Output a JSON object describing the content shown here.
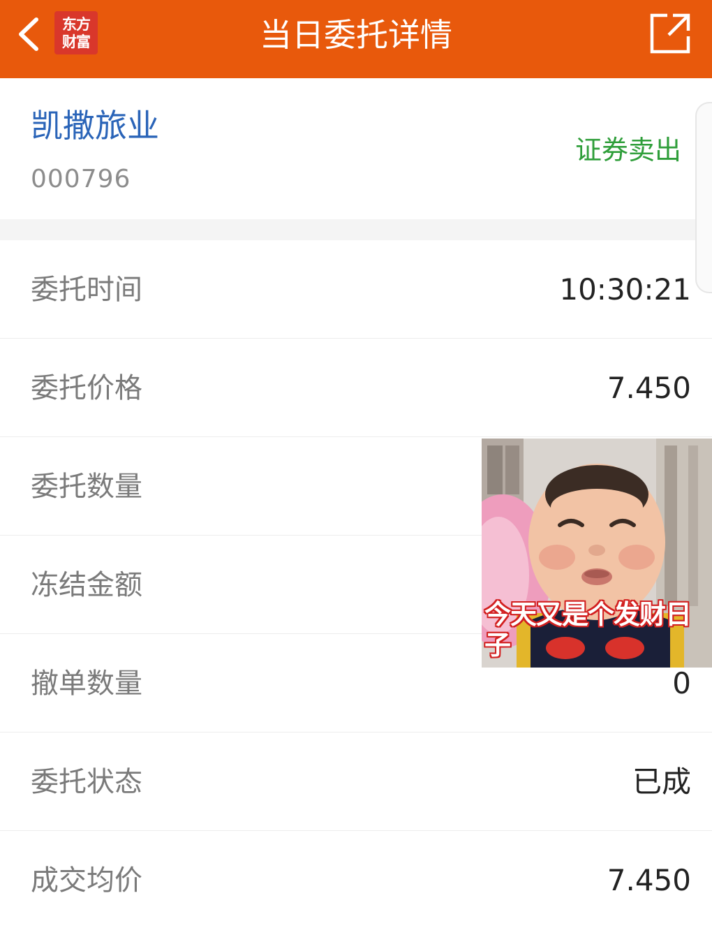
{
  "header": {
    "title": "当日委托详情",
    "logo_line1": "东方",
    "logo_line2": "财富",
    "background_color": "#E8590C",
    "back_icon": "chevron-left-icon",
    "share_icon": "share-icon"
  },
  "stock": {
    "name": "凯撒旅业",
    "code": "000796",
    "trade_type": "证券卖出",
    "name_color": "#2a64b8",
    "trade_type_color": "#2f9e3a"
  },
  "details": [
    {
      "label": "委托时间",
      "value": "10:30:21"
    },
    {
      "label": "委托价格",
      "value": "7.450"
    },
    {
      "label": "委托数量",
      "value": ""
    },
    {
      "label": "冻结金额",
      "value": ""
    },
    {
      "label": "撤单数量",
      "value": "0"
    },
    {
      "label": "委托状态",
      "value": "已成"
    },
    {
      "label": "成交均价",
      "value": "7.450"
    }
  ],
  "meme": {
    "caption": "今天又是个发财日子"
  }
}
